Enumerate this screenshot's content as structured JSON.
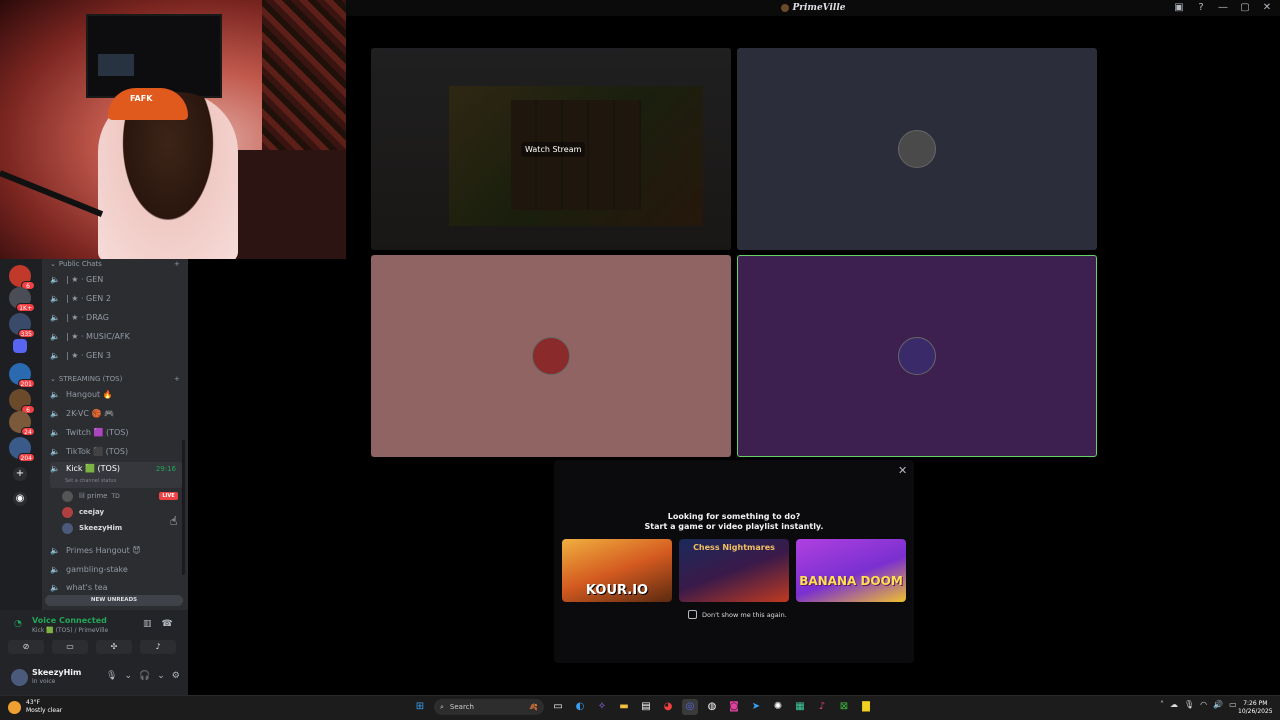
{
  "window": {
    "title": "PrimeVille"
  },
  "server": {
    "categories": {
      "public": "Public Chats",
      "streaming": "STREAMING (TOS)"
    },
    "text_channels": [
      {
        "label": "| ★ · GEN"
      },
      {
        "label": "| ★ · GEN 2"
      },
      {
        "label": "| ★ · DRAG"
      },
      {
        "label": "| ★ · MUSIC/AFK"
      },
      {
        "label": "| ★ · GEN 3"
      }
    ],
    "voice_channels": [
      {
        "label": "Hangout 🔥"
      },
      {
        "label": "2K-VC 🏀 🎮"
      },
      {
        "label": "Twitch 🟪 (TOS)"
      },
      {
        "label": "TikTok ⬛ (TOS)"
      }
    ],
    "active_channel": {
      "label": "Kick 🟩 (TOS)",
      "timer": "29:16",
      "status": "Set a channel status"
    },
    "members": [
      {
        "name": "lil prime",
        "tag": "TD"
      },
      {
        "name": "ceejay"
      },
      {
        "name": "SkeezyHim"
      }
    ],
    "live_badge": "LIVE",
    "more_channels": [
      {
        "label": "Primes Hangout 😈"
      },
      {
        "label": "gambling-stake"
      },
      {
        "label": "what's tea"
      }
    ],
    "new_unreads": "NEW UNREADS"
  },
  "rail": {
    "badges": [
      "6",
      "1K+",
      "335",
      "201",
      "6",
      "24",
      "204"
    ]
  },
  "voice": {
    "status": "Voice Connected",
    "location": "Kick 🟩 (TOS) / PrimeVille"
  },
  "user": {
    "name": "SkeezyHim",
    "status": "In voice"
  },
  "stage": {
    "watch_stream": "Watch Stream"
  },
  "activity": {
    "heading1": "Looking for something to do?",
    "heading2": "Start a game or video playlist instantly.",
    "cards": [
      "KOUR.IO",
      "Chess Nightmares",
      "BANANA DOOM"
    ],
    "dont_show": "Don't show me this again."
  },
  "taskbar": {
    "weather_temp": "43°F",
    "weather_desc": "Mostly clear",
    "search": "Search",
    "time": "7:26 PM",
    "date": "10/26/2025"
  }
}
